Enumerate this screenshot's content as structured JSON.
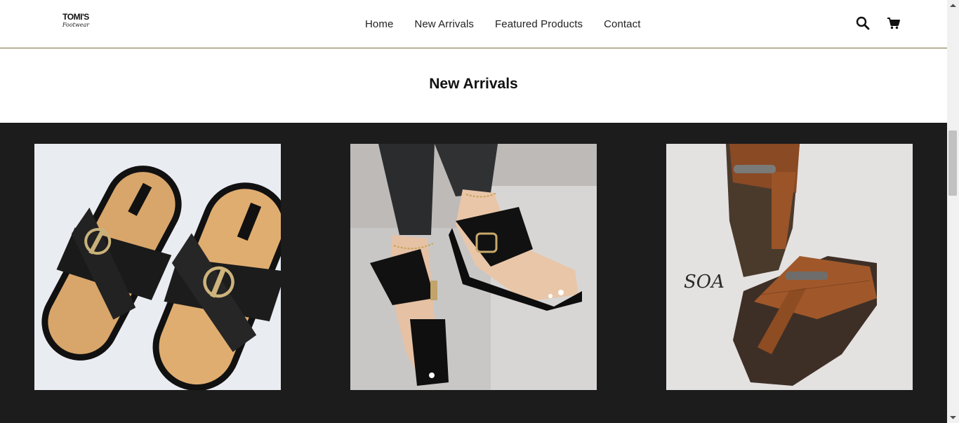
{
  "brand": {
    "name": "TOMI'S",
    "tagline": "Footwear"
  },
  "nav": {
    "items": [
      {
        "label": "Home"
      },
      {
        "label": "New Arrivals"
      },
      {
        "label": "Featured Products"
      },
      {
        "label": "Contact"
      }
    ]
  },
  "header_icons": {
    "search": "search-icon",
    "cart": "cart-icon"
  },
  "section": {
    "title": "New Arrivals"
  },
  "products": [
    {
      "image": "black-cross-strap-slide-sandals",
      "watermark": ""
    },
    {
      "image": "black-toe-post-sandals-on-feet",
      "watermark": ""
    },
    {
      "image": "brown-croc-leather-toe-post-sandals",
      "watermark": "SOA"
    }
  ],
  "colors": {
    "header_border": "#7a6a3a",
    "band_background": "#1c1c1c",
    "text": "#222222"
  }
}
